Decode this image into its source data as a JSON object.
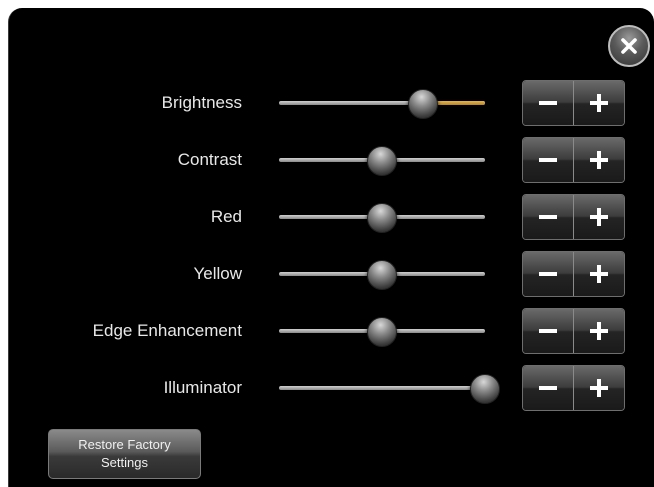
{
  "close_button": {
    "icon": "close-icon"
  },
  "settings": [
    {
      "label": "Brightness",
      "level": 0.7,
      "active": true
    },
    {
      "label": "Contrast",
      "level": 0.5,
      "active": false
    },
    {
      "label": "Red",
      "level": 0.5,
      "active": false
    },
    {
      "label": "Yellow",
      "level": 0.5,
      "active": false
    },
    {
      "label": "Edge Enhancement",
      "level": 0.5,
      "active": false
    },
    {
      "label": "Illuminator",
      "level": 1.0,
      "active": false
    }
  ],
  "stepper": {
    "minus": "−",
    "plus": "+"
  },
  "restore": {
    "label_line1": "Restore Factory",
    "label_line2": "Settings"
  },
  "colors": {
    "background": "#000000",
    "accent": "#e8b44a",
    "text": "#e8e8e8"
  }
}
